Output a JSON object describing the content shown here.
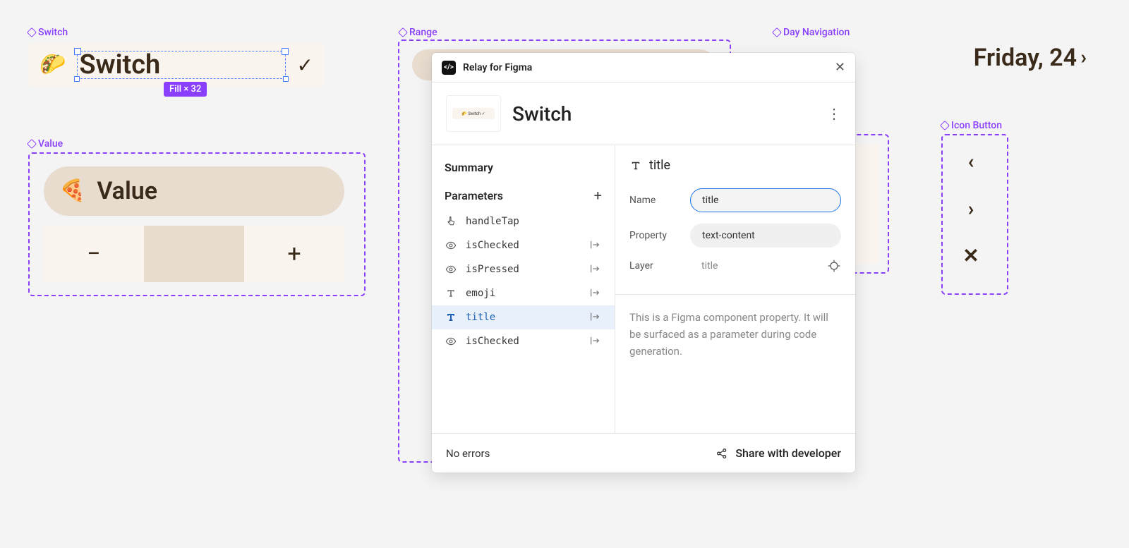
{
  "canvas": {
    "switch": {
      "label": "Switch",
      "emoji": "🌮",
      "title": "Switch",
      "selection_badge": "Fill × 32"
    },
    "value": {
      "label": "Value",
      "emoji": "🍕",
      "title": "Value",
      "buttons": {
        "minus": "−",
        "plus": "+"
      }
    },
    "range": {
      "label": "Range"
    },
    "day_nav": {
      "label": "Day Navigation",
      "title": "Friday, 24",
      "icon_button_label": "Icon Button"
    }
  },
  "panel": {
    "app_title": "Relay for Figma",
    "component_name": "Switch",
    "summary_label": "Summary",
    "parameters_label": "Parameters",
    "parameters": [
      {
        "icon": "tap",
        "name": "handleTap",
        "arrow": false
      },
      {
        "icon": "eye",
        "name": "isChecked",
        "arrow": true
      },
      {
        "icon": "eye",
        "name": "isPressed",
        "arrow": true
      },
      {
        "icon": "text",
        "name": "emoji",
        "arrow": true
      },
      {
        "icon": "text",
        "name": "title",
        "arrow": true,
        "selected": true
      },
      {
        "icon": "eye",
        "name": "isChecked",
        "arrow": true
      }
    ],
    "detail": {
      "heading": "title",
      "name_label": "Name",
      "name_value": "title",
      "property_label": "Property",
      "property_value": "text-content",
      "layer_label": "Layer",
      "layer_value": "title",
      "description": "This is a Figma component property. It will be surfaced as a parameter during code generation."
    },
    "footer": {
      "status": "No errors",
      "share": "Share with developer"
    }
  }
}
